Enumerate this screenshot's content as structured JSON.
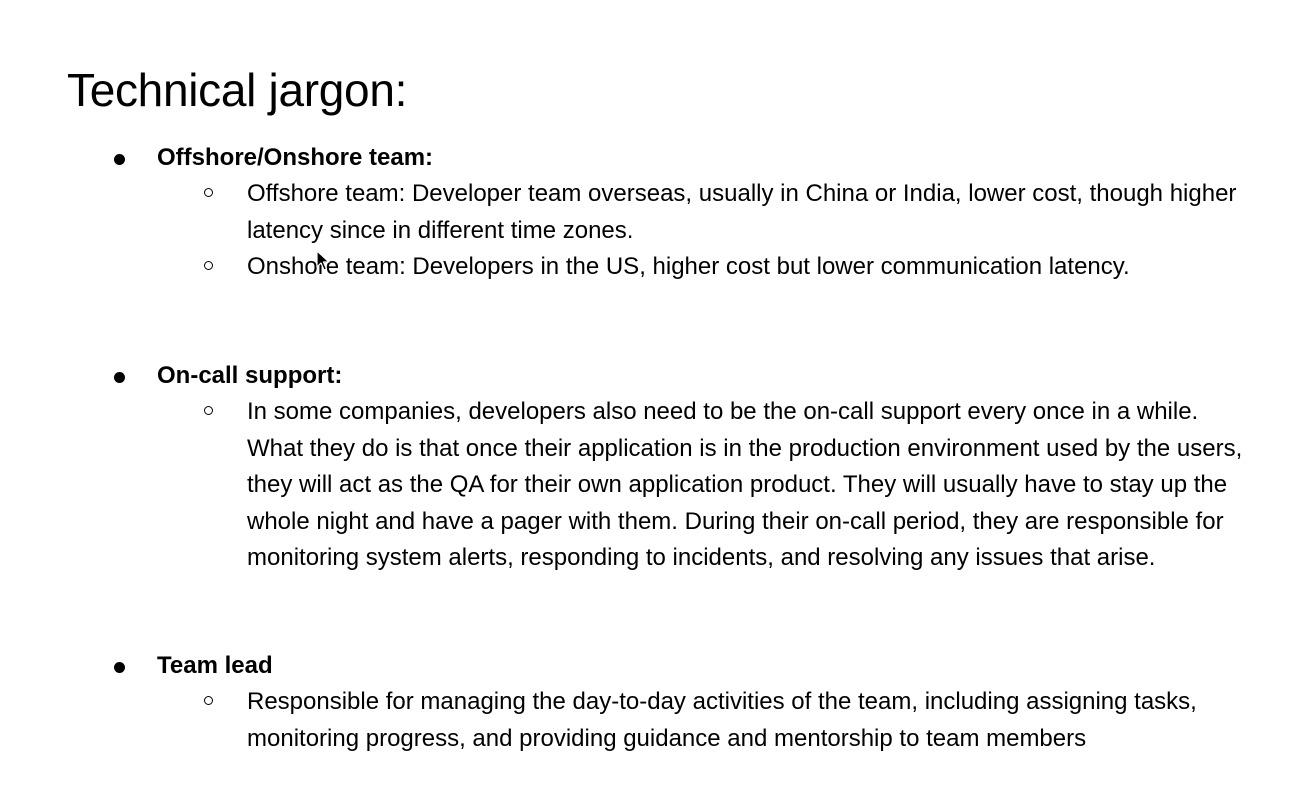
{
  "title": "Technical jargon:",
  "sections": [
    {
      "heading": "Offshore/Onshore team:",
      "items": [
        "Offshore team: Developer team overseas, usually in China or India, lower cost, though higher latency since in different time zones.",
        "Onshore team: Developers in the US, higher cost but lower communication latency."
      ]
    },
    {
      "heading": "On-call support:",
      "items": [
        "In some companies, developers also need to be the on-call support every once in a while. What they do is that once their application is in the production environment used by the users, they will act as the QA for their own application product. They will usually have to stay up the whole night and have a pager with them. During their on-call period, they are responsible for monitoring system alerts, responding to incidents, and resolving any issues that arise."
      ]
    },
    {
      "heading": "Team lead",
      "items": [
        "Responsible for managing the day-to-day activities of the team, including assigning tasks, monitoring progress, and providing guidance and mentorship to team members"
      ]
    }
  ],
  "icons": {
    "bullet": "filled-circle",
    "sub_bullet": "hollow-circle",
    "cursor": "mouse-pointer-icon"
  }
}
